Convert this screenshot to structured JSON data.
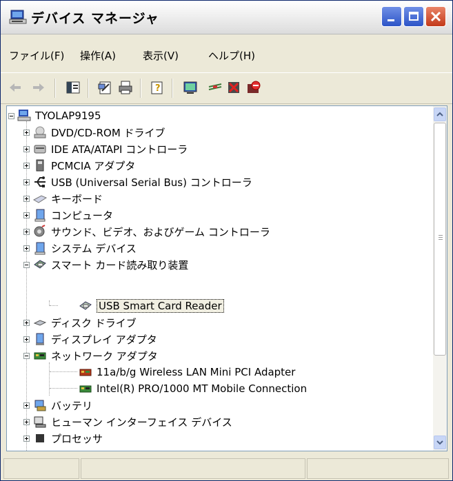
{
  "window": {
    "title": "デバイス マネージャ",
    "icon": "computer-icon"
  },
  "menubar": {
    "items": [
      {
        "label": "ファイル(F)"
      },
      {
        "label": "操作(A)"
      },
      {
        "label": "表示(V)"
      },
      {
        "label": "ヘルプ(H)"
      }
    ]
  },
  "toolbar": {
    "icons": [
      "back-icon",
      "forward-icon",
      "properties-pane-icon",
      "properties-icon",
      "print-icon",
      "help-icon",
      "scan-hardware-icon",
      "update-driver-icon",
      "uninstall-icon",
      "disable-icon"
    ]
  },
  "tree": {
    "root": "TYOLAP9195",
    "nodes": [
      {
        "label": "DVD/CD-ROM ドライブ",
        "icon": "dvd-drive-icon",
        "expanded": false
      },
      {
        "label": "IDE ATA/ATAPI コントローラ",
        "icon": "ide-controller-icon",
        "expanded": false
      },
      {
        "label": "PCMCIA アダプタ",
        "icon": "pcmcia-icon",
        "expanded": false
      },
      {
        "label": "USB (Universal Serial Bus) コントローラ",
        "icon": "usb-icon",
        "expanded": false
      },
      {
        "label": "キーボード",
        "icon": "keyboard-icon",
        "expanded": false
      },
      {
        "label": "コンピュータ",
        "icon": "computer-node-icon",
        "expanded": false
      },
      {
        "label": "サウンド、ビデオ、およびゲーム コントローラ",
        "icon": "sound-icon",
        "expanded": false
      },
      {
        "label": "システム デバイス",
        "icon": "system-device-icon",
        "expanded": false
      },
      {
        "label": "スマート カード読み取り装置",
        "icon": "smart-card-reader-icon",
        "expanded": true,
        "children": [
          {
            "label": "USB Smart Card Reader",
            "icon": "smart-card-reader-icon",
            "selected": true
          }
        ]
      },
      {
        "label": "ディスク ドライブ",
        "icon": "disk-drive-icon",
        "expanded": false
      },
      {
        "label": "ディスプレイ アダプタ",
        "icon": "display-adapter-icon",
        "expanded": false
      },
      {
        "label": "ネットワーク アダプタ",
        "icon": "network-adapter-icon",
        "expanded": true,
        "children": [
          {
            "label": "11a/b/g Wireless LAN Mini PCI Adapter",
            "icon": "network-adapter-icon"
          },
          {
            "label": "Intel(R) PRO/1000 MT Mobile Connection",
            "icon": "network-adapter-icon"
          }
        ]
      },
      {
        "label": "バッテリ",
        "icon": "battery-icon",
        "expanded": false
      },
      {
        "label": "ヒューマン インターフェイス デバイス",
        "icon": "hid-icon",
        "expanded": false
      },
      {
        "label": "プロセッサ",
        "icon": "processor-icon",
        "expanded": false
      }
    ]
  },
  "colors": {
    "selection_bg": "#f1efe2",
    "window_bg": "#ece9d8"
  }
}
